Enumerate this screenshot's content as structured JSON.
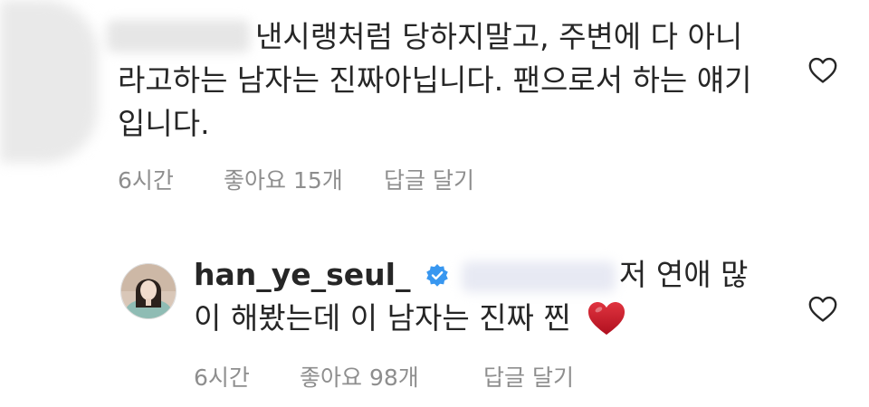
{
  "comments": [
    {
      "text": "낸시랭처럼 당하지말고, 주변에 다 아니라고하는 남자는 진짜아닙니다. 팬으로서 하는 얘기입니다.",
      "time": "6시간",
      "likes_label": "좋아요 15개",
      "reply_label": "답글 달기"
    },
    {
      "username": "han_ye_seul_",
      "text_line1": "저 연애 많",
      "text_line2": "이 해봤는데 이 남자는 진짜 찐",
      "time": "6시간",
      "likes_label": "좋아요 98개",
      "reply_label": "답글 달기"
    }
  ],
  "icons": {
    "like": "heart-outline-icon",
    "verified": "verified-badge-icon",
    "emoji": "red-heart-emoji"
  },
  "colors": {
    "text": "#262626",
    "meta": "#8e8e8e",
    "verified": "#3897f0",
    "emoji_heart": "#c8102e"
  }
}
